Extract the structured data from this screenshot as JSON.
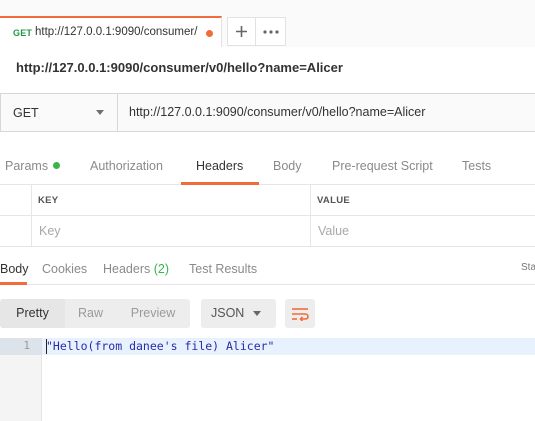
{
  "tab": {
    "method": "GET",
    "url": "http://127.0.0.1:9090/consumer/",
    "unsaved": true
  },
  "tab_actions": {
    "add_icon": "plus-icon",
    "more_icon": "more-horizontal-icon"
  },
  "request": {
    "name": "http://127.0.0.1:9090/consumer/v0/hello?name=Alicer",
    "method": "GET",
    "url": "http://127.0.0.1:9090/consumer/v0/hello?name=Alicer"
  },
  "request_tabs": [
    {
      "label": "Params",
      "has_indicator": true
    },
    {
      "label": "Authorization"
    },
    {
      "label": "Headers",
      "active": true
    },
    {
      "label": "Body"
    },
    {
      "label": "Pre-request Script"
    },
    {
      "label": "Tests"
    }
  ],
  "headers_table": {
    "columns": [
      "KEY",
      "VALUE"
    ],
    "placeholder_row": {
      "key": "Key",
      "value": "Value"
    }
  },
  "response_tabs": [
    {
      "label": "Body",
      "active": true
    },
    {
      "label": "Cookies"
    },
    {
      "label": "Headers",
      "count": "(2)"
    },
    {
      "label": "Test Results"
    }
  ],
  "response_status": "Sta",
  "response_toolbar": {
    "views": [
      "Pretty",
      "Raw",
      "Preview"
    ],
    "active_view": "Pretty",
    "format": "JSON",
    "wrap_icon": "wrap-lines-icon"
  },
  "response_body": {
    "line_numbers": [
      "1"
    ],
    "lines": [
      "\"Hello(from danee's file) Alicer\""
    ]
  },
  "colors": {
    "accent": "#f26b3a",
    "get_method": "#1e9a4a",
    "indicator": "#3ab54a",
    "string_value": "#2a2aa8"
  }
}
